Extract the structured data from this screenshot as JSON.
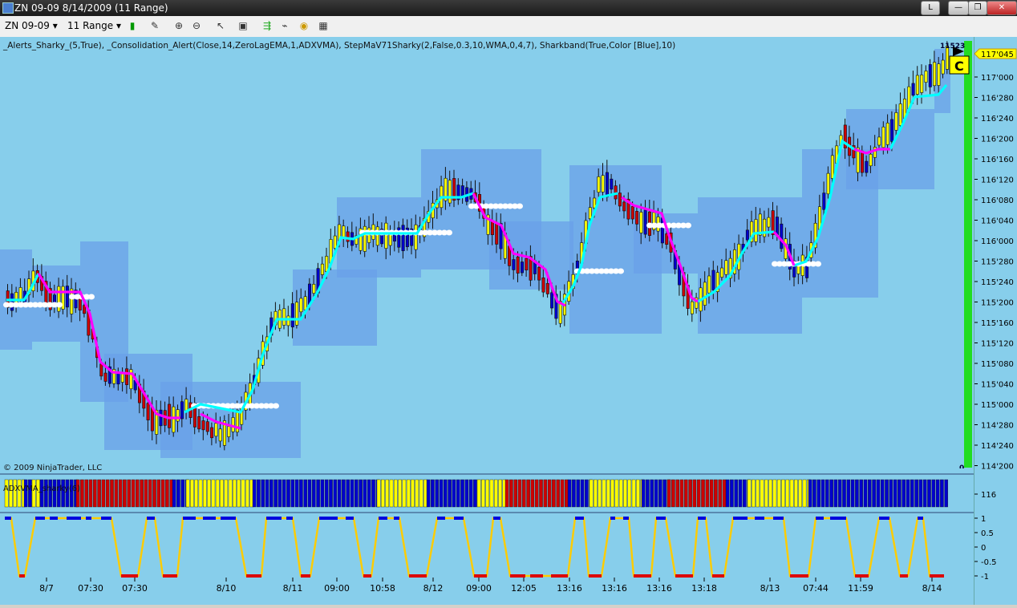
{
  "window": {
    "title": "ZN 09-09  8/14/2009 (11 Range)",
    "min_label": "L",
    "controls": [
      "—",
      "❐",
      "✕"
    ]
  },
  "toolbar": {
    "instrument": "ZN 09-09",
    "period": "11 Range"
  },
  "indicator_line": "_Alerts_Sharky_(5,True), _Consolidation_Alert(Close,14,ZeroLagEMA,1,ADXVMA), StepMaV71Sharky(2,False,0.3,10,WMA,0,4,7), Sharkband(True,Color [Blue],10)",
  "copyright": "© 2009 NinjaTrader, LLC",
  "panel2_label": "ADXVMA_sharky(6)",
  "panel2_axis": "116",
  "panel3_axis": [
    "1",
    "0.5",
    "0",
    "-0.5",
    "-1"
  ],
  "price_axis": [
    "117'000",
    "116'280",
    "116'240",
    "116'200",
    "116'160",
    "116'120",
    "116'080",
    "116'040",
    "116'000",
    "115'280",
    "115'240",
    "115'200",
    "115'160",
    "115'120",
    "115'080",
    "115'040",
    "115'000",
    "114'280",
    "114'240",
    "114'200"
  ],
  "last_price": "117'045",
  "top_price_label": "11523",
  "volume_label_bottom": "0",
  "c_badge": "C",
  "time_axis": [
    "8/7",
    "07:30",
    "07:30",
    "8/10",
    "8/11",
    "09:00",
    "10:58",
    "8/12",
    "09:00",
    "12:05",
    "13:16",
    "13:16",
    "13:16",
    "13:18",
    "8/13",
    "07:44",
    "11:59",
    "8/14"
  ],
  "colors": {
    "band": "#6aa0e8",
    "up_bar": "#ffff00",
    "down_bar": "#cc0000",
    "neutral_bar": "#0000cc",
    "step_up": "#00ffff",
    "step_down": "#ff00ff",
    "consolidation": "#ffffff"
  }
}
